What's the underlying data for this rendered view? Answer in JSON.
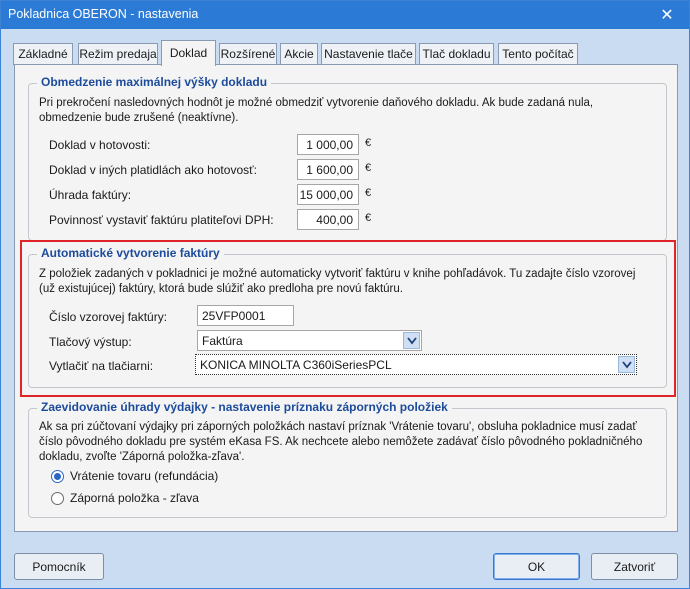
{
  "window": {
    "title": "Pokladnica OBERON - nastavenia"
  },
  "tabs": [
    {
      "label": "Základné"
    },
    {
      "label": "Režim predaja"
    },
    {
      "label": "Doklad"
    },
    {
      "label": "Rozšírené"
    },
    {
      "label": "Akcie"
    },
    {
      "label": "Nastavenie tlače"
    },
    {
      "label": "Tlač dokladu"
    },
    {
      "label": "Tento počítač"
    }
  ],
  "limits": {
    "title": "Obmedzenie maximálnej výšky dokladu",
    "description_line1": "Pri prekročení nasledovných hodnôt je možné obmedziť vytvorenie daňového dokladu.  Ak bude zadaná nula,",
    "description_line2": "obmedzenie bude zrušené (neaktívne).",
    "rows": [
      {
        "label": "Doklad v hotovosti:",
        "value": "1 000,00",
        "unit": "€"
      },
      {
        "label": "Doklad v iných platidlách ako hotovosť:",
        "value": "1 600,00",
        "unit": "€"
      },
      {
        "label": "Úhrada faktúry:",
        "value": "15 000,00",
        "unit": "€"
      },
      {
        "label": "Povinnosť vystaviť faktúru platiteľovi DPH:",
        "value": "400,00",
        "unit": "€"
      }
    ]
  },
  "invoice": {
    "title": "Automatické vytvorenie faktúry",
    "description_line1": "Z položiek zadaných v pokladnici je možné automaticky vytvoriť faktúru v knihe pohľadávok. Tu zadajte číslo vzorovej",
    "description_line2": "(už existujúcej) faktúry, ktorá bude slúžiť ako predloha pre novú faktúru.",
    "sample_label": "Číslo vzorovej faktúry:",
    "sample_value": "25VFP0001",
    "output_label": "Tlačový výstup:",
    "output_value": "Faktúra",
    "printer_label": "Vytlačiť na tlačiarni:",
    "printer_value": "KONICA MINOLTA C360iSeriesPCL"
  },
  "refund": {
    "title": "Zaevidovanie úhrady výdajky - nastavenie príznaku záporných položiek",
    "description_line1": "Ak sa pri zúčtovaní výdajky pri záporných položkách nastaví príznak 'Vrátenie tovaru', obsluha pokladnice musí zadať",
    "description_line2": "číslo pôvodného dokladu pre systém eKasa FS. Ak nechcete alebo nemôžete zadávať číslo pôvodného pokladničného",
    "description_line3": "dokladu, zvoľte 'Záporná položka-zľava'.",
    "option_return": "Vrátenie tovaru (refundácia)",
    "option_discount": "Záporná položka - zľava"
  },
  "buttons": {
    "help": "Pomocník",
    "ok": "OK",
    "close": "Zatvoriť"
  },
  "colors": {
    "titlebar": "#2b7bd6",
    "legend": "#1d4b9b",
    "highlight_box": "#e0242b"
  }
}
